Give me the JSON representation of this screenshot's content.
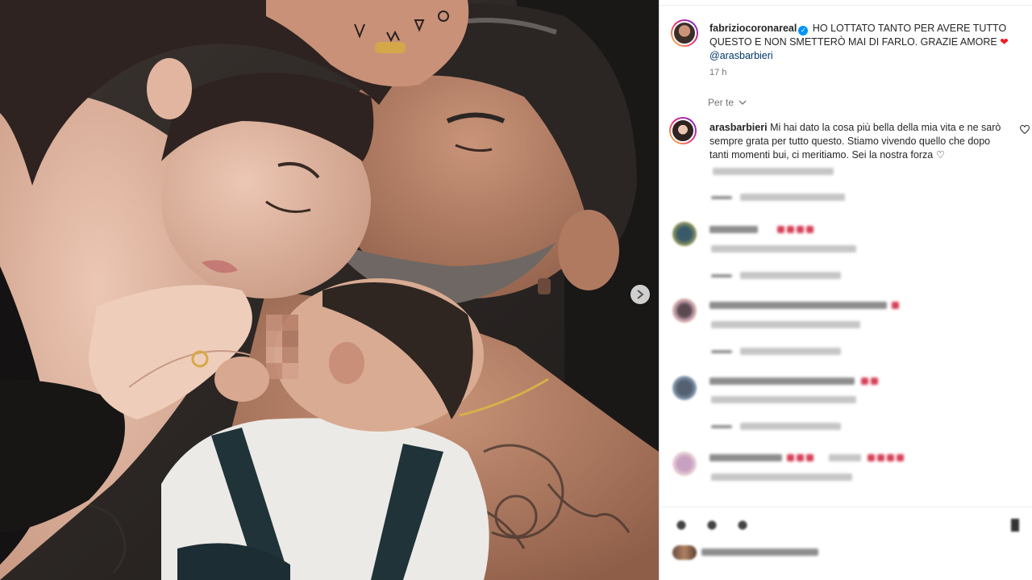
{
  "post": {
    "username": "fabriziocoronareal",
    "verified_mark": "✓",
    "caption": "HO LOTTATO TANTO PER AVERE TUTTO QUESTO E NON SMETTERÒ MAI DI FARLO. GRAZIE AMORE",
    "caption_emoji": "❤",
    "mention": "@arasbarbieri",
    "time": "17 h",
    "translate_label": "Per te",
    "next_icon": "chevron-right-icon"
  },
  "comments": [
    {
      "username": "arasbarbieri",
      "text": "Mi hai dato la cosa più bella della mia vita e ne sarò sempre grata per tutto questo. Stiamo vivendo quello che dopo tanti momenti bui, ci meritiamo. Sei la nostra forza",
      "emoji": "♡",
      "like_icon": "heart-outline-icon"
    }
  ],
  "colors": {
    "accent_blue": "#0095f6",
    "mention_blue": "#00376b",
    "heart_red": "#ed1c24",
    "muted_text": "#737373",
    "border": "#dbdbdb"
  }
}
